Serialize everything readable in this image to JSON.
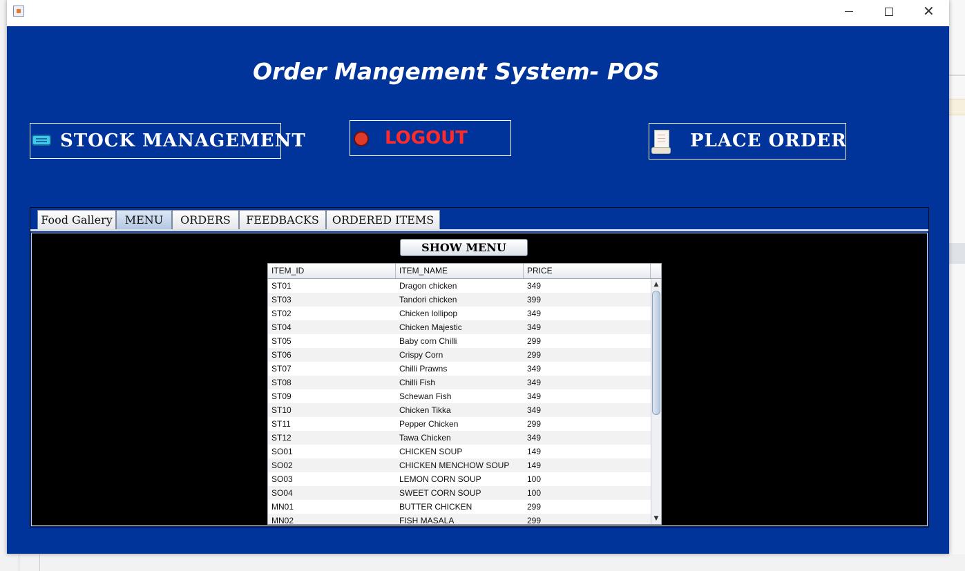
{
  "window": {
    "buttons": {
      "minimize": "—",
      "maximize": "☐",
      "close": "✕"
    }
  },
  "header": {
    "title": "Order Mangement System- POS"
  },
  "actions": {
    "stock_label": "STOCK MANAGEMENT",
    "logout_label": "LOGOUT",
    "order_label": "PLACE ORDER"
  },
  "tabs": [
    {
      "label": "Food Gallery"
    },
    {
      "label": "MENU",
      "active": true
    },
    {
      "label": "ORDERS"
    },
    {
      "label": "FEEDBACKS"
    },
    {
      "label": "ORDERED ITEMS"
    }
  ],
  "menu_panel": {
    "show_menu_label": "SHOW MENU",
    "columns": [
      "ITEM_ID",
      "ITEM_NAME",
      "PRICE"
    ],
    "rows": [
      [
        "ST01",
        "Dragon chicken",
        "349"
      ],
      [
        "ST03",
        "Tandori chicken",
        "399"
      ],
      [
        "ST02",
        "Chicken lollipop",
        "349"
      ],
      [
        "ST04",
        "Chicken Majestic",
        "349"
      ],
      [
        "ST05",
        "Baby corn Chilli",
        "299"
      ],
      [
        "ST06",
        "Crispy Corn",
        "299"
      ],
      [
        "ST07",
        "Chilli Prawns",
        "349"
      ],
      [
        "ST08",
        "Chilli Fish",
        "349"
      ],
      [
        "ST09",
        "Schewan Fish",
        "349"
      ],
      [
        "ST10",
        "Chicken Tikka",
        "349"
      ],
      [
        "ST11",
        "Pepper Chicken",
        "299"
      ],
      [
        "ST12",
        "Tawa Chicken",
        "349"
      ],
      [
        "SO01",
        "CHICKEN SOUP",
        "149"
      ],
      [
        "SO02",
        "CHICKEN MENCHOW SOUP",
        "149"
      ],
      [
        "SO03",
        "LEMON CORN SOUP",
        "100"
      ],
      [
        "SO04",
        "SWEET CORN SOUP",
        "100"
      ],
      [
        "MN01",
        "BUTTER CHICKEN",
        "299"
      ],
      [
        "MN02",
        "FISH MASALA",
        "299"
      ]
    ]
  },
  "colors": {
    "window_background": "#00349a",
    "logout_text": "#ff2a2a",
    "table_area": "#000000"
  },
  "icons": {
    "app": "java-cup-icon",
    "stock": "ticket-icon",
    "logout": "red-circle-icon",
    "order": "receipt-scroll-icon"
  }
}
